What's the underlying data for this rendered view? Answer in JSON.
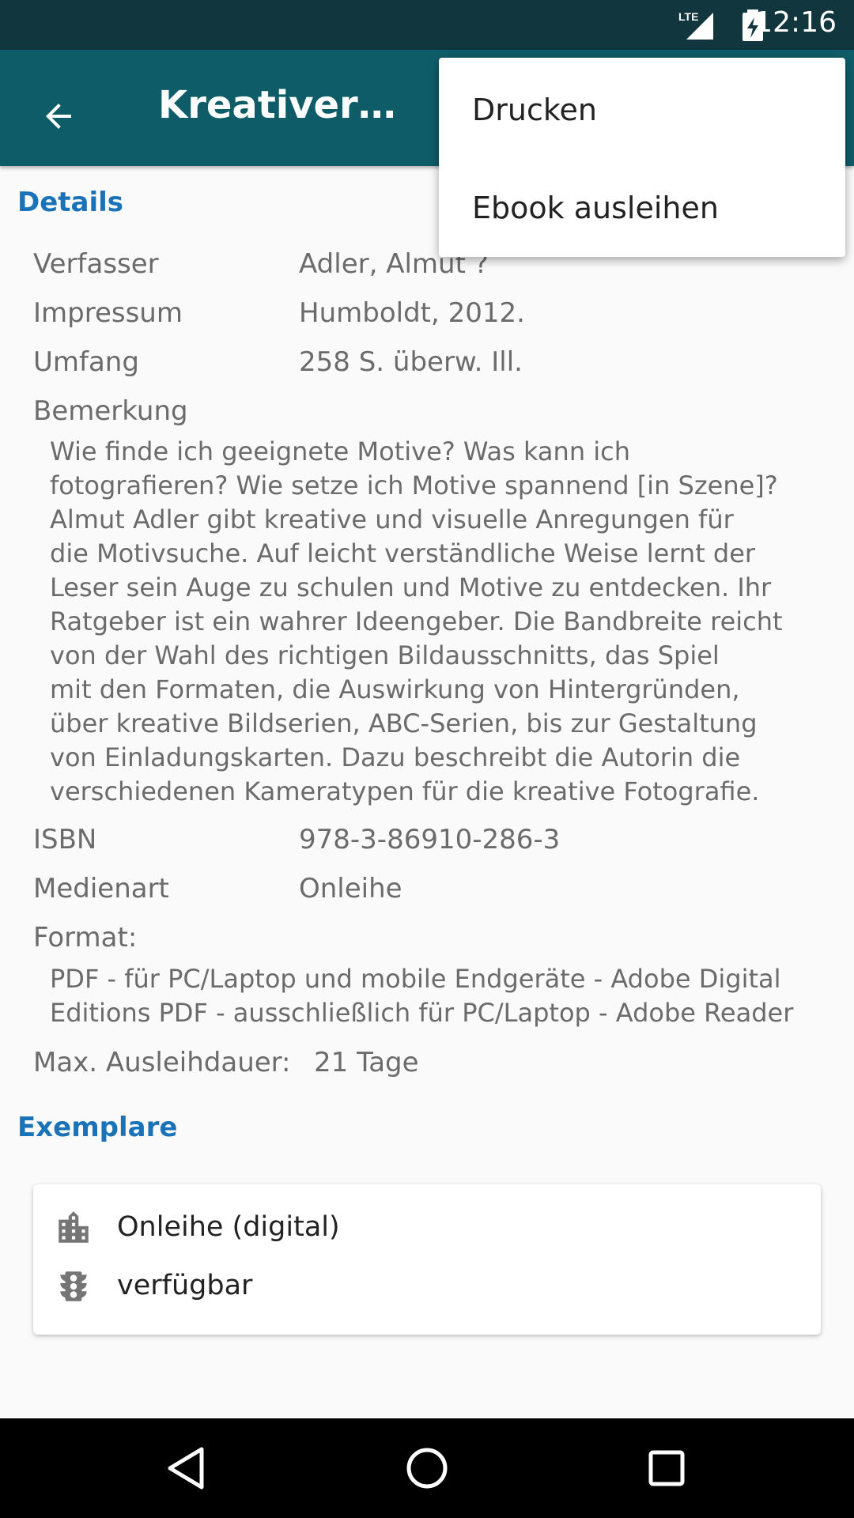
{
  "status": {
    "time": "12:16",
    "network": "LTE"
  },
  "appbar": {
    "title": "Kreativer…",
    "back_icon": "arrow-back-icon"
  },
  "menu": {
    "items": [
      "Drucken",
      "Ebook ausleihen"
    ]
  },
  "details": {
    "title": "Details",
    "rows": [
      {
        "label": "Verfasser",
        "value": "Adler, Almut ?"
      },
      {
        "label": "Impressum",
        "value": "Humboldt, 2012."
      },
      {
        "label": "Umfang",
        "value": "258 S. überw. Ill."
      }
    ],
    "bemerkung_label": "Bemerkung",
    "bemerkung_lines": [
      "Wie finde ich geeignete Motive? Was kann ich",
      "fotografieren? Wie setze ich Motive spannend [in Szene]?",
      "Almut Adler gibt kreative und visuelle Anregungen für",
      "die Motivsuche. Auf leicht verständliche Weise lernt der",
      "Leser sein Auge zu schulen und Motive zu entdecken. Ihr",
      "Ratgeber ist ein wahrer Ideengeber. Die Bandbreite reicht",
      "von der Wahl des richtigen Bildausschnitts, das Spiel",
      "mit den Formaten, die Auswirkung von Hintergründen,",
      "über kreative Bildserien, ABC-Serien, bis zur Gestaltung",
      "von Einladungskarten. Dazu beschreibt die Autorin die",
      "verschiedenen Kameratypen für die kreative Fotografie."
    ],
    "isbn_label": "ISBN",
    "isbn_value": "978-3-86910-286-3",
    "medienart_label": "Medienart",
    "medienart_value": "Onleihe",
    "format_label": "Format:",
    "format_lines": [
      "PDF - für PC/Laptop und mobile Endgeräte - Adobe Digital",
      "Editions PDF - ausschließlich für PC/Laptop - Adobe Reader"
    ],
    "ausleih_label": "Max. Ausleihdauer:",
    "ausleih_value": "21 Tage"
  },
  "exemplare": {
    "title": "Exemplare",
    "location": "Onleihe (digital)",
    "status": "verfügbar",
    "location_icon": "building-icon",
    "status_icon": "traffic-light-icon"
  },
  "colors": {
    "appbar": "#0f5c69",
    "statusbar": "#11363e",
    "accent": "#1a73b8"
  }
}
